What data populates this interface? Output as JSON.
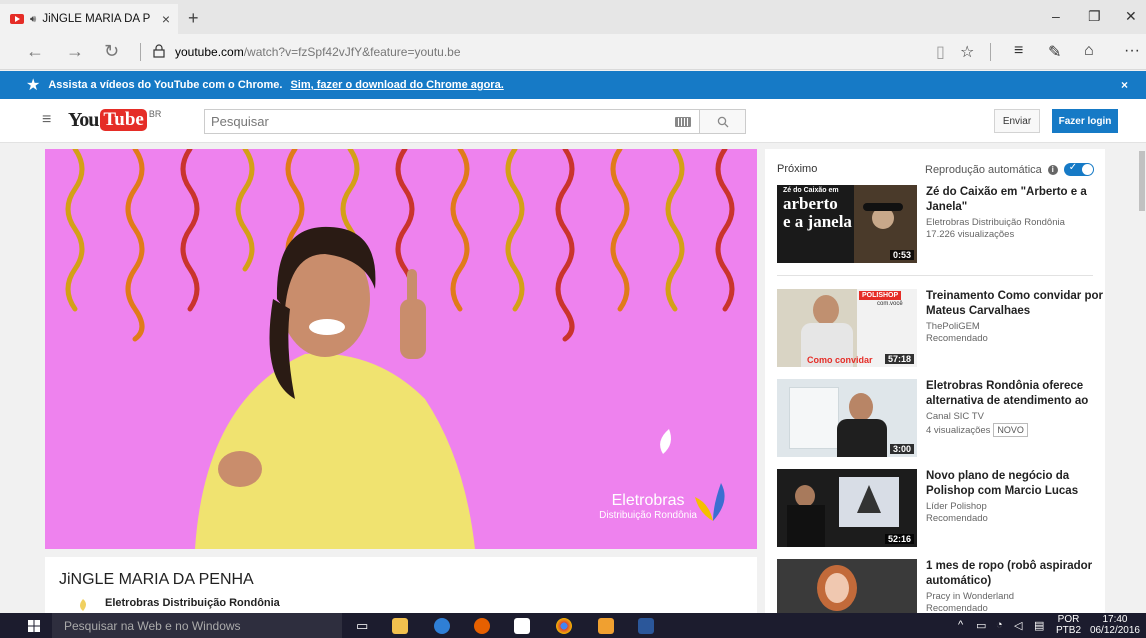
{
  "browser": {
    "tab_title": "JiNGLE MARIA DA P",
    "tab_close": "×",
    "new_tab": "+",
    "url_host": "youtube.com",
    "url_path": "/watch?v=fzSpf42vJfY&feature=youtu.be",
    "window_controls": [
      "–",
      "❐",
      "✕"
    ],
    "more": "···"
  },
  "promo": {
    "text": "Assista a vídeos do YouTube com o Chrome.",
    "link": "Sim, fazer o download do Chrome agora.",
    "close": "×"
  },
  "masthead": {
    "logo_you": "You",
    "logo_tube": "Tube",
    "logo_region": "BR",
    "search_placeholder": "Pesquisar",
    "send_label": "Enviar",
    "login_label": "Fazer login"
  },
  "player": {
    "brand_name": "Eletrobras",
    "brand_sub": "Distribuição Rondônia"
  },
  "video": {
    "title": "JiNGLE MARIA DA PENHA",
    "channel": "Eletrobras Distribuição Rondônia"
  },
  "sidebar": {
    "next_label": "Próximo",
    "autoplay_label": "Reprodução automática",
    "autoplay_info": "i",
    "items": [
      {
        "title": "Zé do Caixão em \"Arberto e a Janela\"",
        "channel": "Eletrobras Distribuição Rondônia",
        "meta": "17.226 visualizações",
        "duration": "0:53",
        "thumb_text_top": "Zé do Caixão em",
        "thumb_text_big1": "arberto",
        "thumb_text_big2": "e a janela"
      },
      {
        "title": "Treinamento Como convidar por Mateus Carvalhaes",
        "channel": "ThePoliGEM",
        "meta": "Recomendado",
        "duration": "57:18",
        "thumb_text": "POLISHOP",
        "thumb_text2": "com.você",
        "thumb_caption": "Como convidar"
      },
      {
        "title": "Eletrobras Rondônia oferece alternativa de atendimento ao",
        "channel": "Canal SIC TV",
        "meta": "4 visualizações",
        "badge": "NOVO",
        "duration": "3:00"
      },
      {
        "title": "Novo plano de negócio da Polishop com Marcio Lucas",
        "channel": "Líder Polishop",
        "meta": "Recomendado",
        "duration": "52:16"
      },
      {
        "title": "1 mes de ropo (robô aspirador automático)",
        "channel": "Pracy in Wonderland",
        "meta": "Recomendado"
      }
    ]
  },
  "taskbar": {
    "search_placeholder": "Pesquisar na Web e no Windows",
    "lang_top": "POR",
    "lang_bottom": "PTB2",
    "time": "17:40",
    "date": "06/12/2016"
  }
}
